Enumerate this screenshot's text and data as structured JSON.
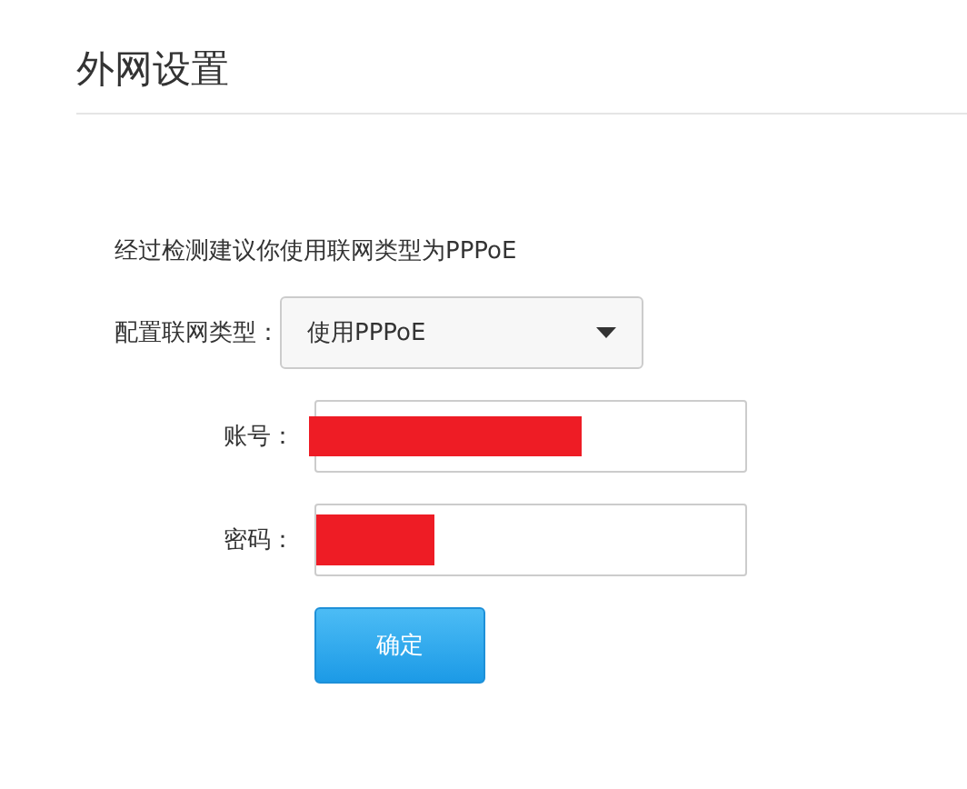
{
  "title": "外网设置",
  "notice": "经过检测建议你使用联网类型为PPPoE",
  "connection_type": {
    "label": "配置联网类型：",
    "value": "使用PPPoE"
  },
  "fields": [
    {
      "kind": "account",
      "label": "账号：",
      "redacted": true
    },
    {
      "kind": "password",
      "label": "密码：",
      "redacted": true
    }
  ],
  "confirm_button": "确定"
}
